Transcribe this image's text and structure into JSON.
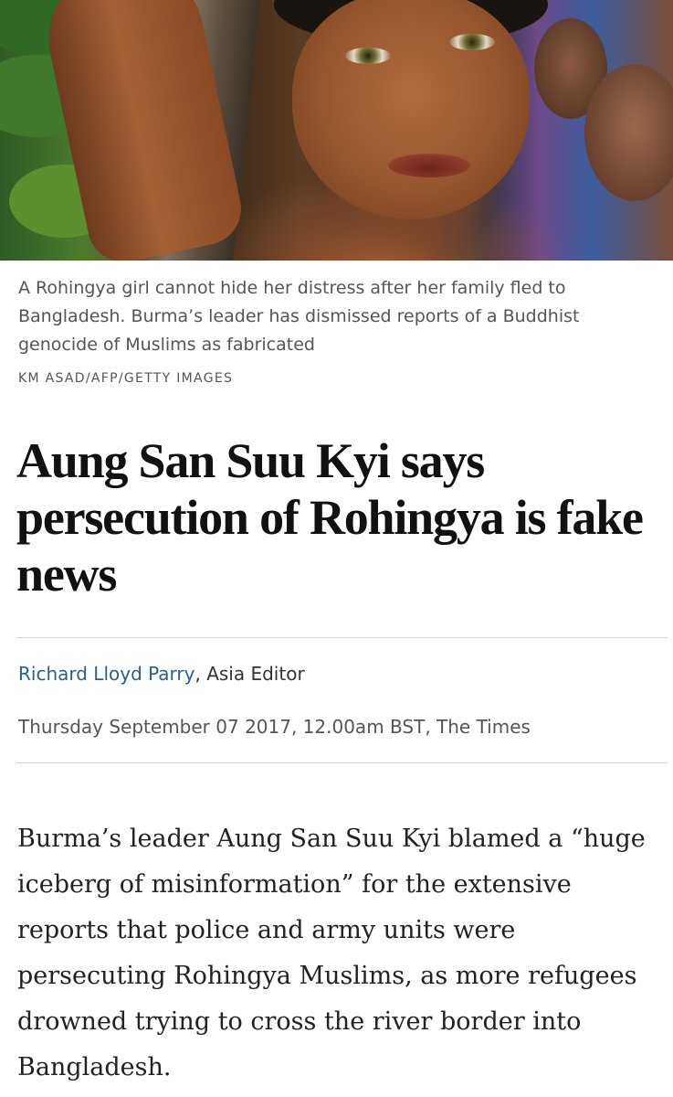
{
  "image": {
    "alt_icon": "photo-rohingya-girl"
  },
  "caption": {
    "text": "A Rohingya girl cannot hide her distress after her family fled to Bangladesh. Burma’s leader has dismissed reports of a Buddhist genocide of Muslims as fabricated",
    "credit": "KM ASAD/AFP/GETTY IMAGES"
  },
  "headline": "Aung San Suu Kyi says persecution of Rohingya is fake news",
  "byline": {
    "author": "Richard Lloyd Parry",
    "role": ", Asia Editor"
  },
  "dateline": "Thursday September 07 2017, 12.00am BST, The Times",
  "body": {
    "paragraph1": "Burma’s leader Aung San Suu Kyi blamed a “huge iceberg of misinformation” for the extensive reports that police and army units were persecuting Rohingya Muslims, as more refugees drowned trying to cross the river border into Bangladesh."
  },
  "colors": {
    "link": "#2b5f8a",
    "caption": "#555555",
    "headline": "#111111",
    "rule": "#d6d6d6"
  }
}
